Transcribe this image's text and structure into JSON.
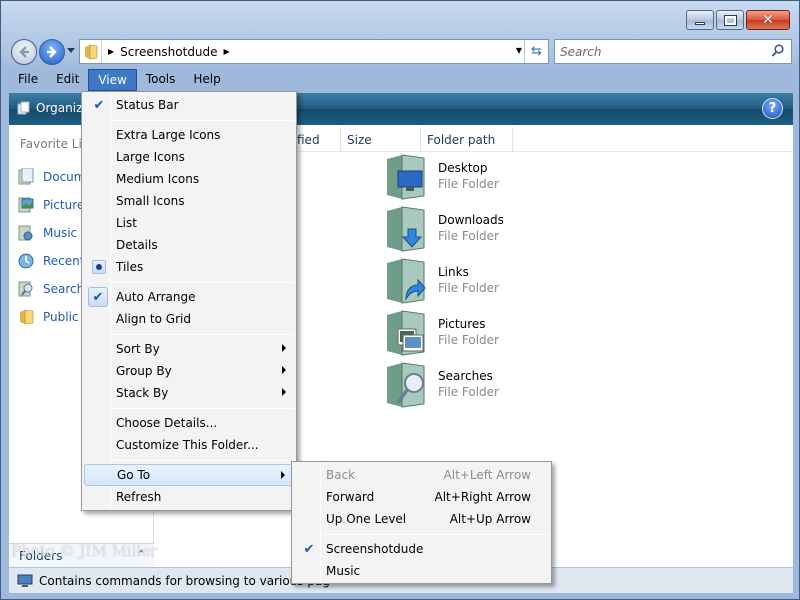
{
  "address": {
    "path": "Screenshotdude"
  },
  "search": {
    "placeholder": "Search"
  },
  "menubar": [
    "File",
    "Edit",
    "View",
    "Tools",
    "Help"
  ],
  "toolbar": {
    "organize": "Organiz"
  },
  "favorites": {
    "title": "Favorite Lin",
    "items": [
      {
        "label": "Docum",
        "icon": "documents-icon"
      },
      {
        "label": "Picture",
        "icon": "pictures-icon"
      },
      {
        "label": "Music",
        "icon": "music-icon"
      },
      {
        "label": "Recent",
        "icon": "recent-icon"
      },
      {
        "label": "Search",
        "icon": "search-folder-icon"
      },
      {
        "label": "Public",
        "icon": "public-icon"
      }
    ]
  },
  "folders_label": "Folders",
  "columns": {
    "date_tail": "fied",
    "size": "Size",
    "path": "Folder path"
  },
  "tiles": [
    {
      "name": "Desktop",
      "type": "File Folder",
      "icon": "desktop-folder-icon"
    },
    {
      "name": "Downloads",
      "type": "File Folder",
      "icon": "downloads-folder-icon"
    },
    {
      "name": "Links",
      "type": "File Folder",
      "icon": "links-folder-icon"
    },
    {
      "name": "Pictures",
      "type": "File Folder",
      "icon": "pictures-folder-icon"
    },
    {
      "name": "Searches",
      "type": "File Folder",
      "icon": "searches-folder-icon"
    }
  ],
  "status": {
    "text": "Contains commands for browsing to various pag"
  },
  "view_menu": {
    "status_bar": "Status Bar",
    "extra_large_icons": "Extra Large Icons",
    "large_icons": "Large Icons",
    "medium_icons": "Medium Icons",
    "small_icons": "Small Icons",
    "list": "List",
    "details": "Details",
    "tiles": "Tiles",
    "auto_arrange": "Auto Arrange",
    "align_to_grid": "Align to Grid",
    "sort_by": "Sort By",
    "group_by": "Group By",
    "stack_by": "Stack By",
    "choose_details": "Choose Details...",
    "customize_folder": "Customize This Folder...",
    "go_to": "Go To",
    "refresh": "Refresh"
  },
  "goto_menu": {
    "back": {
      "label": "Back",
      "shortcut": "Alt+Left Arrow"
    },
    "forward": {
      "label": "Forward",
      "shortcut": "Alt+Right Arrow"
    },
    "up": {
      "label": "Up One Level",
      "shortcut": "Alt+Up Arrow"
    },
    "screenshotdude": "Screenshotdude",
    "music": "Music"
  },
  "watermark": "Photo © JIM Miller"
}
